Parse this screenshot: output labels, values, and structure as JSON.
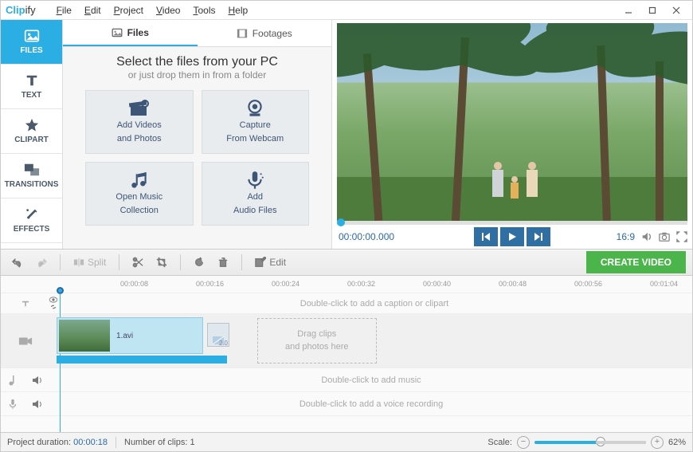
{
  "app": {
    "brand_prefix": "Clip",
    "brand_suffix": "ify"
  },
  "menu": [
    "File",
    "Edit",
    "Project",
    "Video",
    "Tools",
    "Help"
  ],
  "left_tabs": [
    {
      "label": "FILES",
      "icon": "image-icon",
      "active": true
    },
    {
      "label": "TEXT",
      "icon": "text-icon",
      "active": false
    },
    {
      "label": "CLIPART",
      "icon": "star-icon",
      "active": false
    },
    {
      "label": "TRANSITIONS",
      "icon": "overlap-icon",
      "active": false
    },
    {
      "label": "EFFECTS",
      "icon": "wand-icon",
      "active": false
    }
  ],
  "center_tabs": [
    {
      "label": "Files",
      "icon": "image-icon",
      "active": true
    },
    {
      "label": "Footages",
      "icon": "film-icon",
      "active": false
    }
  ],
  "center": {
    "headline": "Select the files from your PC",
    "sub": "or just drop them in from a folder",
    "buttons": [
      {
        "l1": "Add Videos",
        "l2": "and Photos",
        "icon": "clapper-icon"
      },
      {
        "l1": "Capture",
        "l2": "From Webcam",
        "icon": "webcam-icon"
      },
      {
        "l1": "Open Music",
        "l2": "Collection",
        "icon": "notes-icon"
      },
      {
        "l1": "Add",
        "l2": "Audio Files",
        "icon": "mic-icon"
      }
    ]
  },
  "preview": {
    "timecode": "00:00:00.000",
    "aspect": "16:9"
  },
  "editbar": {
    "split": "Split",
    "edit": "Edit",
    "create": "CREATE VIDEO"
  },
  "timeline": {
    "ticks": [
      "00:00:08",
      "00:00:16",
      "00:00:24",
      "00:00:32",
      "00:00:40",
      "00:00:48",
      "00:00:56",
      "00:01:04"
    ],
    "caption_hint": "Double-click to add a caption or clipart",
    "clip_name": "1.avi",
    "clip_end_label": "2.0",
    "dropzone_l1": "Drag clips",
    "dropzone_l2": "and photos here",
    "music_hint": "Double-click to add music",
    "voice_hint": "Double-click to add a voice recording"
  },
  "status": {
    "proj_dur_label": "Project duration:",
    "proj_dur_value": "00:00:18",
    "clips_label": "Number of clips:",
    "clips_value": "1",
    "scale_label": "Scale:",
    "scale_value": "62%"
  }
}
